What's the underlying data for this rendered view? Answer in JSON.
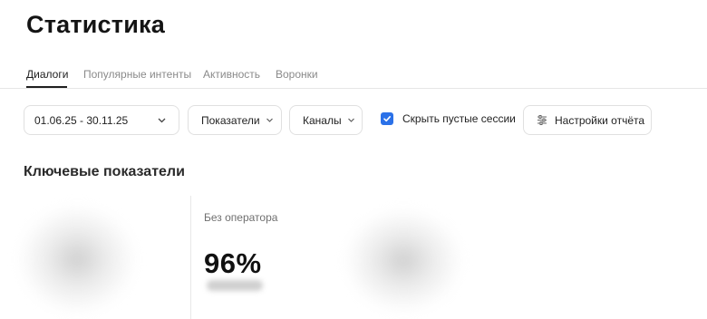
{
  "page": {
    "title": "Статистика"
  },
  "tabs": [
    {
      "label": "Диалоги",
      "active": true
    },
    {
      "label": "Популярные интенты",
      "active": false
    },
    {
      "label": "Активность",
      "active": false
    },
    {
      "label": "Воронки",
      "active": false
    }
  ],
  "filters": {
    "date_range": "01.06.25 - 30.11.25",
    "metrics_label": "Показатели",
    "channels_label": "Каналы",
    "hide_empty_sessions": {
      "label": "Скрыть пустые сессии",
      "checked": true
    },
    "report_settings_label": "Настройки отчёта"
  },
  "section": {
    "title": "Ключевые показатели"
  },
  "kpi": {
    "label": "Без оператора",
    "value": "96%"
  },
  "colors": {
    "accent": "#2b71e8",
    "text": "#141414",
    "muted": "#8a8a8a"
  },
  "icons": {
    "chevron": "chevron-down-icon",
    "settings": "sliders-icon",
    "check": "checkmark-icon"
  }
}
